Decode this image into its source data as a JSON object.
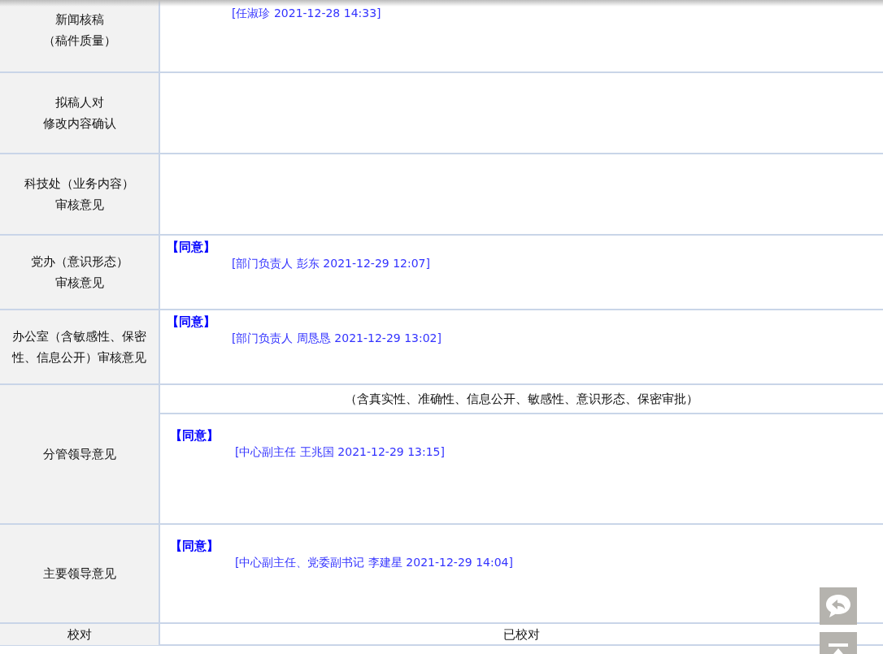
{
  "rows": [
    {
      "label": [
        "新闻核稿",
        "（稿件质量）"
      ],
      "opinions": [
        {
          "signer": "[任淑珍 2021-12-28 14:33]"
        }
      ]
    },
    {
      "label": [
        "拟稿人对",
        "修改内容确认"
      ],
      "opinions": []
    },
    {
      "label": [
        "科技处（业务内容）",
        "审核意见"
      ],
      "opinions": []
    },
    {
      "label": [
        "党办（意识形态）",
        "审核意见"
      ],
      "opinions": [
        {
          "verdict": "【同意】",
          "signer": "[部门负责人 彭东 2021-12-29 12:07]"
        }
      ]
    },
    {
      "label": [
        "办公室（含敏感性、保密",
        "性、信息公开）审核意见"
      ],
      "opinions": [
        {
          "verdict": "【同意】",
          "signer": "[部门负责人 周恳恳 2021-12-29 13:02]"
        }
      ]
    },
    {
      "label": [
        "分管领导意见"
      ],
      "note": "（含真实性、准确性、信息公开、敏感性、意识形态、保密审批）",
      "opinions": [
        {
          "verdict": "【同意】",
          "signer": "[中心副主任 王兆国 2021-12-29 13:15]"
        }
      ]
    },
    {
      "label": [
        "主要领导意见"
      ],
      "opinions": [
        {
          "verdict": "【同意】",
          "signer": "[中心副主任、党委副书记 李建星 2021-12-29 14:04]"
        }
      ]
    },
    {
      "label": [
        "校对"
      ],
      "value": "已校对"
    }
  ]
}
